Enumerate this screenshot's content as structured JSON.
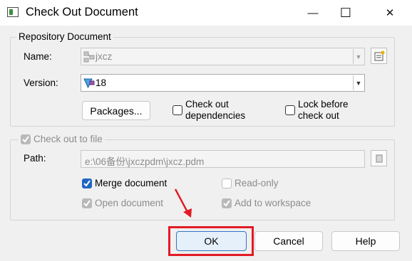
{
  "window": {
    "title": "Check Out Document",
    "minimize_glyph": "—",
    "maximize_glyph": "☐",
    "close_glyph": "✕"
  },
  "repository_group": {
    "legend": "Repository Document",
    "name_label": "Name:",
    "name_value": "jxcz",
    "version_label": "Version:",
    "version_value": "18",
    "packages_button": "Packages...",
    "check_out_dependencies_label": "Check out\ndependencies",
    "lock_before_check_out_label": "Lock before\ncheck out",
    "check_out_dependencies_checked": false,
    "lock_before_check_out_checked": false
  },
  "checkout_group": {
    "check_out_to_file_label": "Check out to file",
    "check_out_to_file_checked": true,
    "path_label": "Path:",
    "path_value": "e:\\06备份\\jxczpdm\\jxcz.pdm",
    "merge_document_label": "Merge document",
    "merge_document_checked": true,
    "read_only_label": "Read-only",
    "read_only_checked": false,
    "open_document_label": "Open document",
    "open_document_checked": true,
    "add_to_workspace_label": "Add to workspace",
    "add_to_workspace_checked": true
  },
  "buttons": {
    "ok": "OK",
    "cancel": "Cancel",
    "help": "Help"
  },
  "colors": {
    "accent": "#1e66c3",
    "highlight": "#e21b24"
  },
  "icons": {
    "app": "document-checkout-icon",
    "name_field": "model-icon",
    "version_field": "version-icon",
    "browse_name": "browse-icon",
    "browse_path": "file-browse-icon"
  }
}
